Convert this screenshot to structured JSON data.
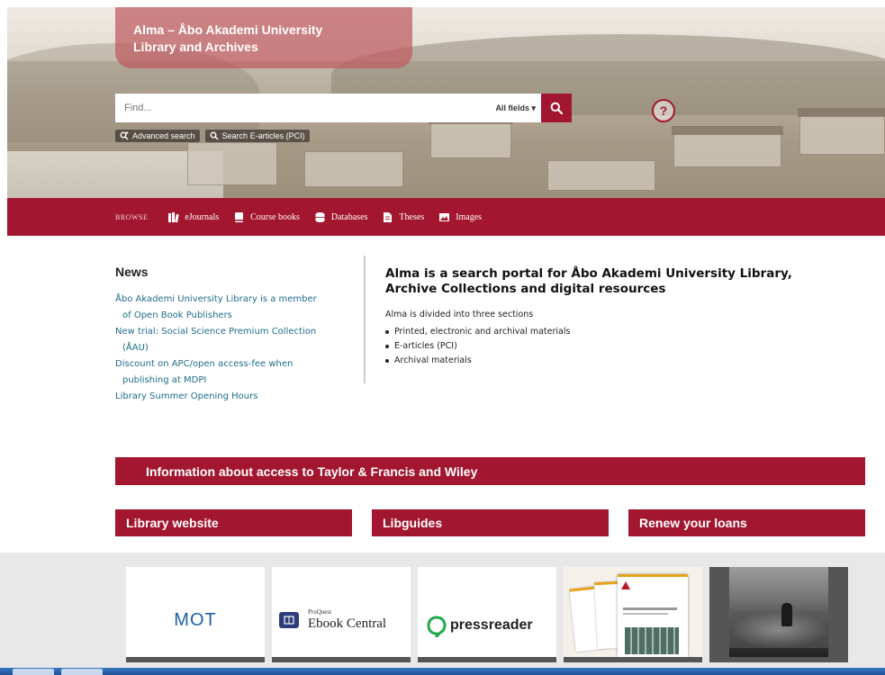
{
  "header": {
    "title_line1": "Alma – Åbo Akademi University",
    "title_line2": "Library and Archives"
  },
  "search": {
    "placeholder": "Find...",
    "field_selected": "All fields",
    "advanced_label": "Advanced search",
    "earticles_label": "Search E-articles (PCI)",
    "help_label": "?"
  },
  "browse": {
    "label": "BROWSE",
    "items": [
      {
        "label": "eJournals",
        "icon": "books-icon"
      },
      {
        "label": "Course books",
        "icon": "book-icon"
      },
      {
        "label": "Databases",
        "icon": "database-icon"
      },
      {
        "label": "Theses",
        "icon": "document-icon"
      },
      {
        "label": "Images",
        "icon": "image-icon"
      }
    ]
  },
  "news": {
    "heading": "News",
    "items": [
      {
        "line1": "Åbo Akademi University Library is a member",
        "line2": "of Open Book Publishers"
      },
      {
        "line1": "New trial: Social Science Premium Collection",
        "line2": "(ÅAU)"
      },
      {
        "line1": "Discount on APC/open access-fee when",
        "line2": "publishing at MDPI"
      },
      {
        "line1": "Library Summer Opening Hours",
        "line2": ""
      }
    ]
  },
  "about": {
    "heading_line1": "Alma is a search portal for Åbo Akademi University Library,",
    "heading_line2": "Archive Collections and digital resources",
    "intro": "Alma is divided into three sections",
    "sections": [
      "Printed, electronic and archival materials",
      "E-articles (PCI)",
      "Archival materials"
    ]
  },
  "banners": {
    "info": "Information about access to Taylor & Francis and Wiley",
    "library_website": "Library website",
    "libguides": "Libguides",
    "renew": "Renew your loans"
  },
  "logos": {
    "mot": "MOT",
    "proquest_small": "ProQuest",
    "ebook_central": "Ebook Central",
    "pressreader": "pressreader"
  },
  "colors": {
    "brand_red": "#a3162f",
    "link_teal": "#1f6c8a"
  }
}
